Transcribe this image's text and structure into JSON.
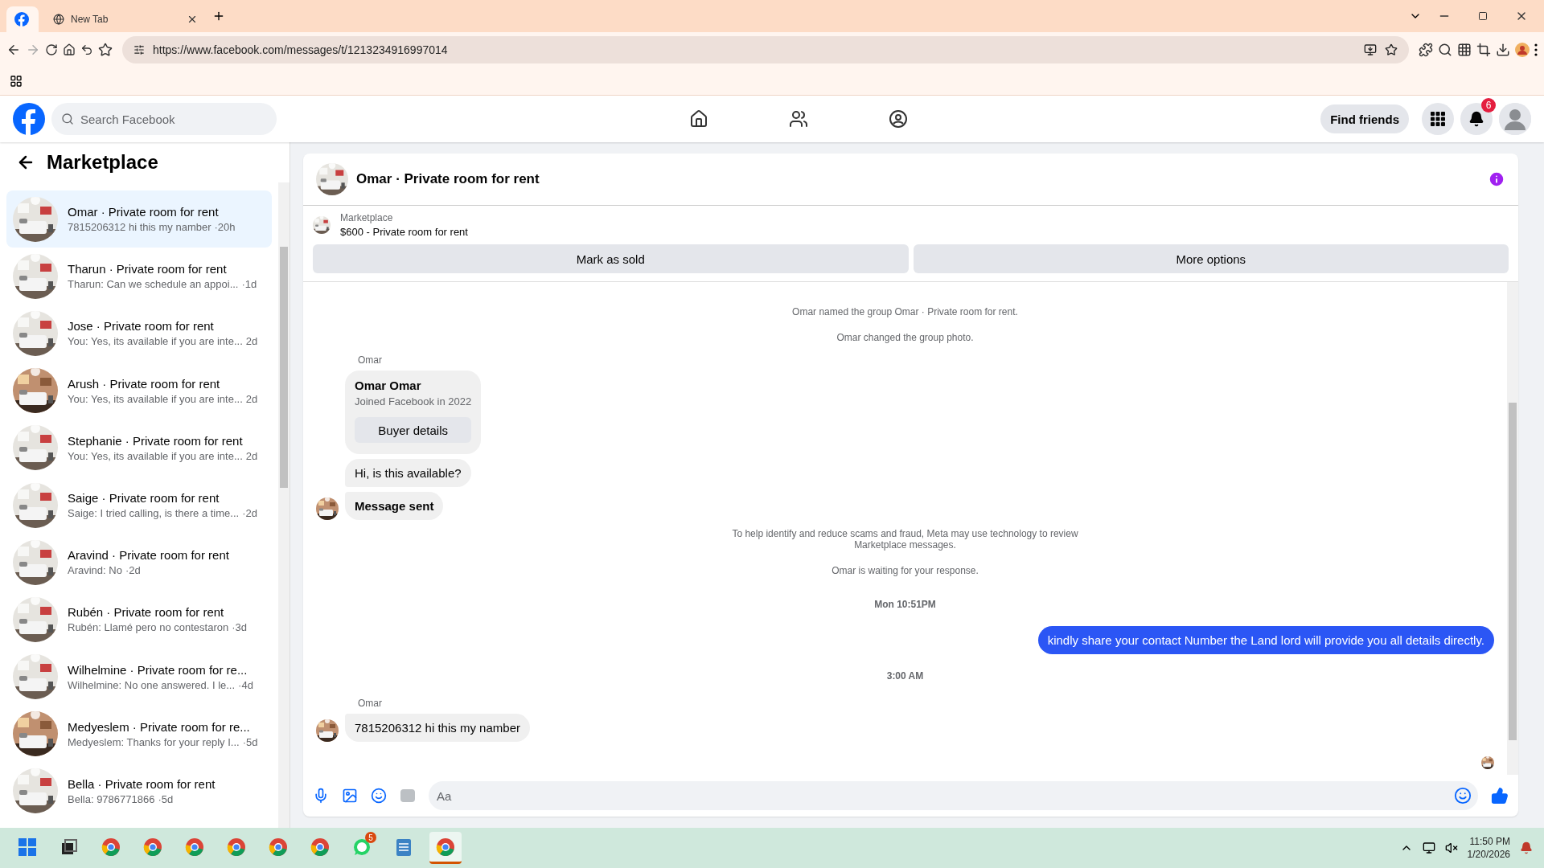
{
  "browser": {
    "tabs": [
      {
        "kind": "pinned",
        "selected": true
      },
      {
        "kind": "normal",
        "title": "New Tab",
        "selected": false
      }
    ],
    "url": "https://www.facebook.com/messages/t/1213234916997014"
  },
  "header": {
    "search": {
      "placeholder": "Search Facebook"
    },
    "find_friends": "Find friends",
    "notification_count": "6"
  },
  "sidebar": {
    "title": "Marketplace",
    "conversations": [
      {
        "name": "Omar · Private room for rent",
        "preview": "7815206312 hi this my namber",
        "time": "·20h",
        "selected": true
      },
      {
        "name": "Tharun · Private room for rent",
        "preview": "Tharun: Can we schedule an appoi...",
        "time": "·1d",
        "selected": false
      },
      {
        "name": "Jose · Private room for rent",
        "preview": "You: Yes, its available if you are inte...",
        "time": "2d",
        "selected": false
      },
      {
        "name": "Arush · Private room for rent",
        "preview": "You: Yes, its available if you are inte...",
        "time": "2d",
        "selected": false
      },
      {
        "name": "Stephanie · Private room for rent",
        "preview": "You: Yes, its available if you are inte...",
        "time": "2d",
        "selected": false
      },
      {
        "name": "Saige · Private room for rent",
        "preview": "Saige: I tried calling, is there a time...",
        "time": "·2d",
        "selected": false
      },
      {
        "name": "Aravind · Private room for rent",
        "preview": "Aravind: No",
        "time": "·2d",
        "selected": false
      },
      {
        "name": "Rubén · Private room for rent",
        "preview": "Rubén: Llamé pero no contestaron",
        "time": "·3d",
        "selected": false
      },
      {
        "name": "Wilhelmine · Private room for re...",
        "preview": "Wilhelmine: No one answered. I le...",
        "time": "·4d",
        "selected": false
      },
      {
        "name": "Medyeslem · Private room for re...",
        "preview": "Medyeslem: Thanks for your reply I...",
        "time": "·5d",
        "selected": false
      },
      {
        "name": "Bella · Private room for rent",
        "preview": "Bella: 9786771866",
        "time": "·5d",
        "selected": false
      }
    ]
  },
  "chat": {
    "title": "Omar · Private room for rent",
    "listing": {
      "label": "Marketplace",
      "title": "$600 - Private room for rent"
    },
    "buttons": [
      "Mark as sold",
      "More options"
    ],
    "messages": [
      {
        "kind": "system",
        "text": "Omar named the group Omar · Private room for rent."
      },
      {
        "kind": "system",
        "text": "Omar changed the group photo."
      },
      {
        "kind": "sender",
        "text": "Omar"
      },
      {
        "kind": "profile",
        "name": "Omar Omar",
        "detail": "Joined Facebook in 2022",
        "button": "Buyer details"
      },
      {
        "kind": "incoming",
        "text": "Hi, is this available?",
        "avatar": false,
        "bold": false
      },
      {
        "kind": "incoming",
        "text": "Message sent",
        "avatar": true,
        "bold": true
      },
      {
        "kind": "system",
        "text": "To help identify and reduce scams and fraud, Meta may use technology to review Marketplace messages."
      },
      {
        "kind": "system",
        "text": "Omar is waiting for your response."
      },
      {
        "kind": "timestamp",
        "text": "Mon 10:51PM"
      },
      {
        "kind": "outgoing",
        "text": "kindly share your contact Number the Land lord will provide you all details directly."
      },
      {
        "kind": "timestamp",
        "text": "3:00 AM"
      },
      {
        "kind": "sender",
        "text": "Omar"
      },
      {
        "kind": "incoming",
        "text": "7815206312 hi this my namber",
        "avatar": true,
        "bold": false
      }
    ],
    "composer": {
      "placeholder": "Aa"
    }
  },
  "taskbar": {
    "apps": [
      {
        "kind": "windows",
        "active": false
      },
      {
        "kind": "taskview",
        "active": false
      },
      {
        "kind": "chrome",
        "active": false
      },
      {
        "kind": "chrome",
        "active": false
      },
      {
        "kind": "chrome",
        "active": false
      },
      {
        "kind": "chrome",
        "active": false
      },
      {
        "kind": "chrome",
        "active": false
      },
      {
        "kind": "chrome",
        "active": false
      },
      {
        "kind": "whatsapp",
        "badge": "5",
        "active": false
      },
      {
        "kind": "notepad",
        "active": false
      },
      {
        "kind": "chrome",
        "active": true
      }
    ],
    "time": "11:50 PM",
    "date": "1/20/2026"
  }
}
